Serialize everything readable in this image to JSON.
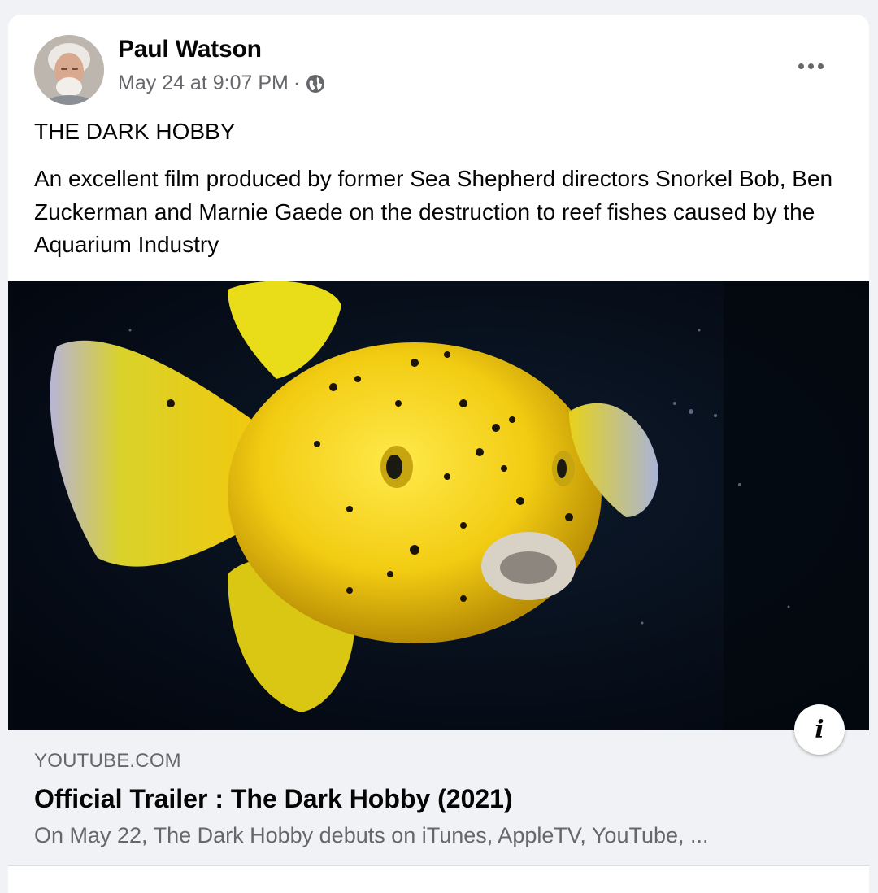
{
  "post": {
    "author": "Paul Watson",
    "timestamp": "May 24 at 9:07 PM",
    "separator": "·",
    "privacy_icon": "globe-icon",
    "more_icon": "more-options-icon",
    "title": "THE DARK HOBBY",
    "body": "An excellent film produced by former Sea Shepherd directors Snorkel Bob, Ben Zuckerman and Marnie Gaede on the destruction to reef fishes caused by the Aquarium Industry"
  },
  "link_preview": {
    "domain": "YOUTUBE.COM",
    "title": "Official Trailer : The Dark Hobby (2021)",
    "description": "On May 22, The Dark Hobby debuts on iTunes, AppleTV, YouTube, ...",
    "info_label": "i",
    "image_subject": "yellow pufferfish on dark background"
  },
  "colors": {
    "card_bg": "#ffffff",
    "page_bg": "#f0f2f5",
    "secondary_text": "#65676b",
    "fish_yellow": "#f2d21b"
  }
}
